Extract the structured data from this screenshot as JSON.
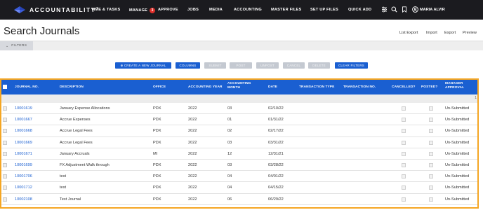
{
  "nav": {
    "brand": "ACCOUNTABILITY",
    "brand_mark": "™",
    "items": [
      {
        "label": "TIME & TASKS"
      },
      {
        "label": "MANAGE",
        "badge": "3"
      },
      {
        "label": "APPROVE"
      },
      {
        "label": "JOBS"
      },
      {
        "label": "MEDIA"
      },
      {
        "label": "ACCOUNTING"
      },
      {
        "label": "MASTER FILES"
      },
      {
        "label": "SET UP FILES"
      },
      {
        "label": "QUICK ADD"
      }
    ],
    "icons": [
      "sliders-icon",
      "search-icon",
      "bookmark-icon",
      "user-circle-icon"
    ],
    "user": "MARIA ALVIR"
  },
  "header": {
    "title": "Search Journals",
    "links": [
      "List Export",
      "Import",
      "Export",
      "Preview"
    ]
  },
  "filters": {
    "label": "FILTERS"
  },
  "actions": [
    {
      "label": "⊕ CREATE A NEW JOURNAL",
      "enabled": true
    },
    {
      "label": "COLUMNS",
      "enabled": true
    },
    {
      "label": "SUBMIT",
      "enabled": false
    },
    {
      "label": "POST",
      "enabled": false
    },
    {
      "label": "UNPOST",
      "enabled": false
    },
    {
      "label": "CANCEL",
      "enabled": false
    },
    {
      "label": "DELETE",
      "enabled": false
    },
    {
      "label": "CLEAR FILTERS",
      "enabled": true
    }
  ],
  "table": {
    "columns": [
      "JOURNAL NO.",
      "DESCRIPTION",
      "OFFICE",
      "ACCOUNTING YEAR",
      "ACCOUNTING MONTH",
      "DATE",
      "TRANSACTION TYPE",
      "TRANSACTION NO.",
      "CANCELLED?",
      "POSTED?",
      "MANAGER APPROVAL"
    ],
    "scroll_glyph": "1",
    "rows": [
      {
        "journal_no": "10001619",
        "description": "January Expense Allocations",
        "office": "PDX",
        "year": "2022",
        "month": "03",
        "date": "02/10/22",
        "manager_approval": "Un-Submitted"
      },
      {
        "journal_no": "10001667",
        "description": "Accrue Expenses",
        "office": "PDX",
        "year": "2022",
        "month": "01",
        "date": "01/31/22",
        "manager_approval": "Un-Submitted"
      },
      {
        "journal_no": "10001668",
        "description": "Accrue Legal Fees",
        "office": "PDX",
        "year": "2022",
        "month": "02",
        "date": "02/17/22",
        "manager_approval": "Un-Submitted"
      },
      {
        "journal_no": "10001669",
        "description": "Accrue Legal Fees",
        "office": "PDX",
        "year": "2022",
        "month": "03",
        "date": "03/31/22",
        "manager_approval": "Un-Submitted"
      },
      {
        "journal_no": "10001671",
        "description": "January Accruals",
        "office": "MI",
        "year": "2022",
        "month": "12",
        "date": "12/31/21",
        "manager_approval": "Un-Submitted"
      },
      {
        "journal_no": "10001699",
        "description": "FX Adjustment Walk through",
        "office": "PDX",
        "year": "2022",
        "month": "03",
        "date": "03/28/22",
        "manager_approval": "Un-Submitted"
      },
      {
        "journal_no": "10001706",
        "description": "test",
        "office": "PDX",
        "year": "2022",
        "month": "04",
        "date": "04/01/22",
        "manager_approval": "Un-Submitted"
      },
      {
        "journal_no": "10001712",
        "description": "test",
        "office": "PDX",
        "year": "2022",
        "month": "04",
        "date": "04/15/22",
        "manager_approval": "Un-Submitted"
      },
      {
        "journal_no": "10002108",
        "description": "Test Journal",
        "office": "PDX",
        "year": "2022",
        "month": "06",
        "date": "06/29/22",
        "manager_approval": "Un-Submitted"
      }
    ]
  },
  "colors": {
    "nav_bg": "#1b1b1f",
    "accent": "#1a5fd1",
    "highlight_border": "#f5a623",
    "badge": "#e0302b"
  }
}
